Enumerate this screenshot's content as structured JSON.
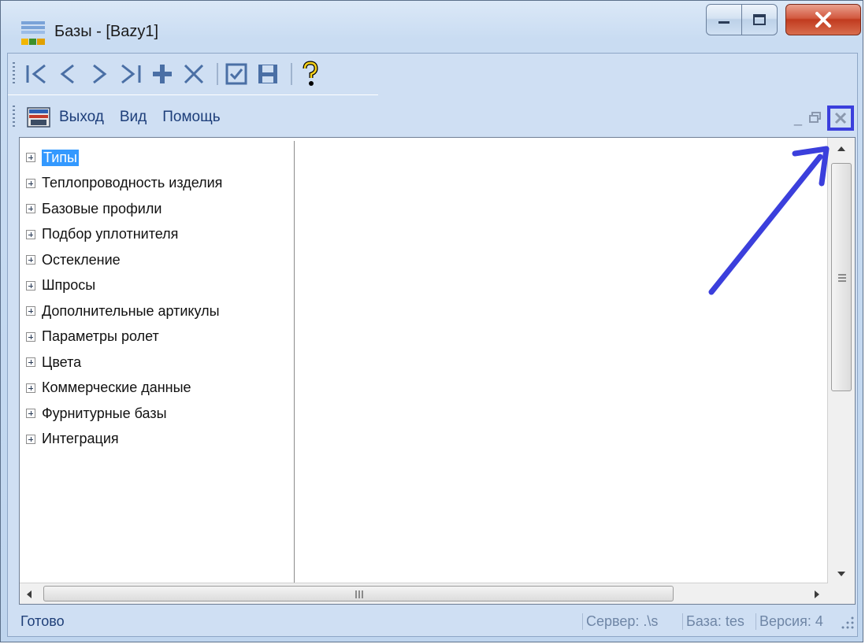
{
  "window": {
    "title": "Базы - [Bazy1]"
  },
  "toolbar": {
    "buttons": [
      {
        "name": "first-record",
        "glyph": "|<"
      },
      {
        "name": "prev-record",
        "glyph": "<"
      },
      {
        "name": "next-record",
        "glyph": ">"
      },
      {
        "name": "last-record",
        "glyph": ">|"
      },
      {
        "name": "add-record",
        "glyph": "+"
      },
      {
        "name": "delete-record",
        "glyph": "×"
      },
      {
        "name": "confirm",
        "glyph": "☑"
      },
      {
        "name": "save",
        "glyph": "💾"
      },
      {
        "name": "help",
        "glyph": "?"
      }
    ]
  },
  "menu": {
    "items": [
      "Выход",
      "Вид",
      "Помощь"
    ]
  },
  "tree": {
    "items": [
      {
        "label": "Типы",
        "selected": true
      },
      {
        "label": "Теплопроводность изделия"
      },
      {
        "label": "Базовые профили"
      },
      {
        "label": "Подбор уплотнителя"
      },
      {
        "label": "Остекление"
      },
      {
        "label": "Шпросы"
      },
      {
        "label": "Дополнительные артикулы"
      },
      {
        "label": "Параметры ролет"
      },
      {
        "label": "Цвета"
      },
      {
        "label": "Коммерческие данные"
      },
      {
        "label": "Фурнитурные базы"
      },
      {
        "label": "Интеграция"
      }
    ]
  },
  "statusbar": {
    "main": "Готово",
    "server": "Сервер: .\\s",
    "database": "База: tes",
    "version": "Версия: 4"
  },
  "colors": {
    "annotation": "#3b3fdc",
    "selection": "#3399ff"
  }
}
